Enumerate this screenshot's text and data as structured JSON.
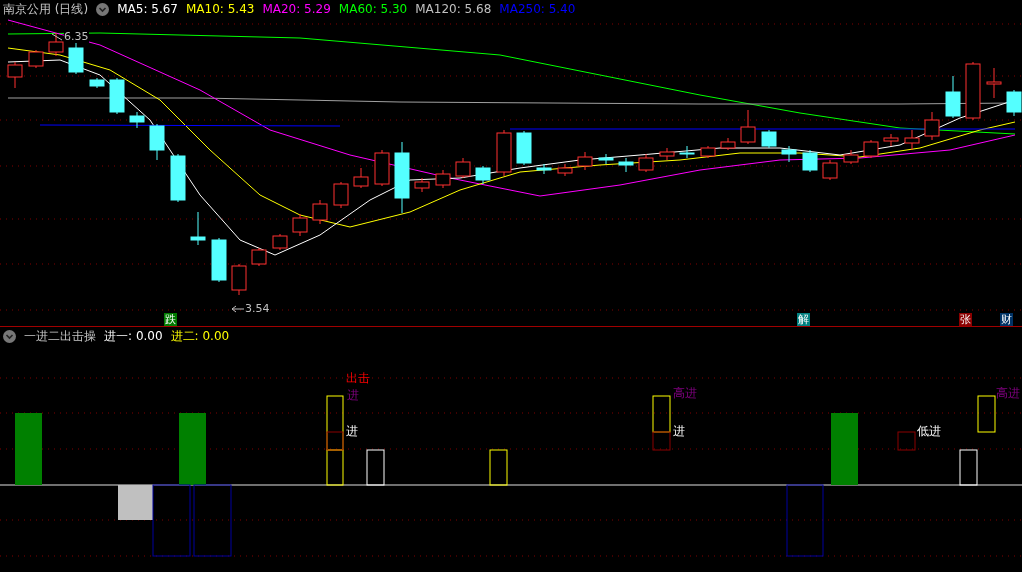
{
  "chart_header": {
    "title": "南京公用 (日线)",
    "indicators": [
      {
        "label": "MA5:",
        "value": "5.67",
        "color": "#ffffff"
      },
      {
        "label": "MA10:",
        "value": "5.43",
        "color": "#ffff00"
      },
      {
        "label": "MA20:",
        "value": "5.29",
        "color": "#ff00ff"
      },
      {
        "label": "MA60:",
        "value": "5.30",
        "color": "#00ff00"
      },
      {
        "label": "MA120:",
        "value": "5.68",
        "color": "#c0c0c0"
      },
      {
        "label": "MA250:",
        "value": "5.40",
        "color": "#0000ff"
      }
    ]
  },
  "price_marks": [
    {
      "text": "6.35"
    },
    {
      "text": "3.54"
    }
  ],
  "event_tags": [
    {
      "text": "跌",
      "color": "#007a00"
    },
    {
      "text": "解",
      "color": "#008080"
    },
    {
      "text": "张",
      "color": "#8b0000"
    },
    {
      "text": "财",
      "color": "#003366"
    }
  ],
  "indicator_header": {
    "title": "一进二出击操",
    "values": [
      {
        "label": "进一:",
        "value": "0.00",
        "color": "#ffffff"
      },
      {
        "label": "进二:",
        "value": "0.00",
        "color": "#ffff00"
      }
    ]
  },
  "signal_labels": [
    {
      "text": "出击",
      "kind": "strike"
    },
    {
      "text": "进",
      "kind": "high"
    },
    {
      "text": "进",
      "kind": "entry"
    },
    {
      "text": "高进",
      "kind": "high"
    },
    {
      "text": "进",
      "kind": "entry"
    },
    {
      "text": "低进",
      "kind": "entry"
    },
    {
      "text": "高进",
      "kind": "high"
    }
  ]
}
